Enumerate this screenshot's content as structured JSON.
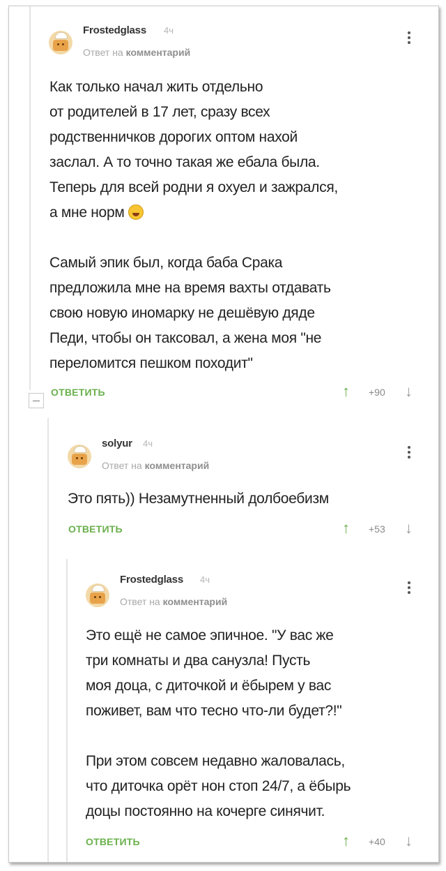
{
  "comments": [
    {
      "username": "Frostedglass",
      "time": "4ч",
      "reply_prefix": "Ответ на",
      "reply_target": "комментарий",
      "lines": [
        "Как только начал жить отдельно",
        "от родителей в 17 лет, сразу всех",
        "родственничков дорогих оптом нахой",
        "заслал. А то точно такая же ебала была.",
        "Теперь для всей родни я охуел и зажрался,",
        "а мне норм"
      ],
      "lines2": [
        "Самый эпик был, когда баба Срака",
        "предложила мне на время вахты отдавать",
        "свою новую иномарку не дешёвую дяде",
        "Педи, чтобы он таксовал, а жена моя \"не",
        "переломится пешком походит\""
      ],
      "reply_label": "ОТВЕТИТЬ",
      "score": "+90"
    },
    {
      "username": "solyur",
      "time": "4ч",
      "reply_prefix": "Ответ на",
      "reply_target": "комментарий",
      "lines": [
        "Это пять)) Незамутненный долбоебизм"
      ],
      "reply_label": "ОТВЕТИТЬ",
      "score": "+53"
    },
    {
      "username": "Frostedglass",
      "time": "4ч",
      "reply_prefix": "Ответ на",
      "reply_target": "комментарий",
      "lines": [
        "Это ещё не самое эпичное. \"У вас же",
        "три комнаты и два санузла! Пусть",
        "моя доца, с диточкой и ёбырем у вас",
        "поживет, вам что тесно что-ли будет?!\""
      ],
      "lines2": [
        "При этом совсем недавно жаловалась,",
        "что диточка орёт нон стоп 24/7, а ёбырь",
        "доцы постоянно на кочерге синячит."
      ],
      "reply_label": "ОТВЕТИТЬ",
      "score": "+40"
    }
  ],
  "icons": {
    "upvote": "arrow-up-icon",
    "downvote": "arrow-down-icon",
    "more": "kebab-menu-icon",
    "collapse": "collapse-minus-icon"
  },
  "colors": {
    "accent": "#6ab04c",
    "muted": "#a8a8a8"
  }
}
